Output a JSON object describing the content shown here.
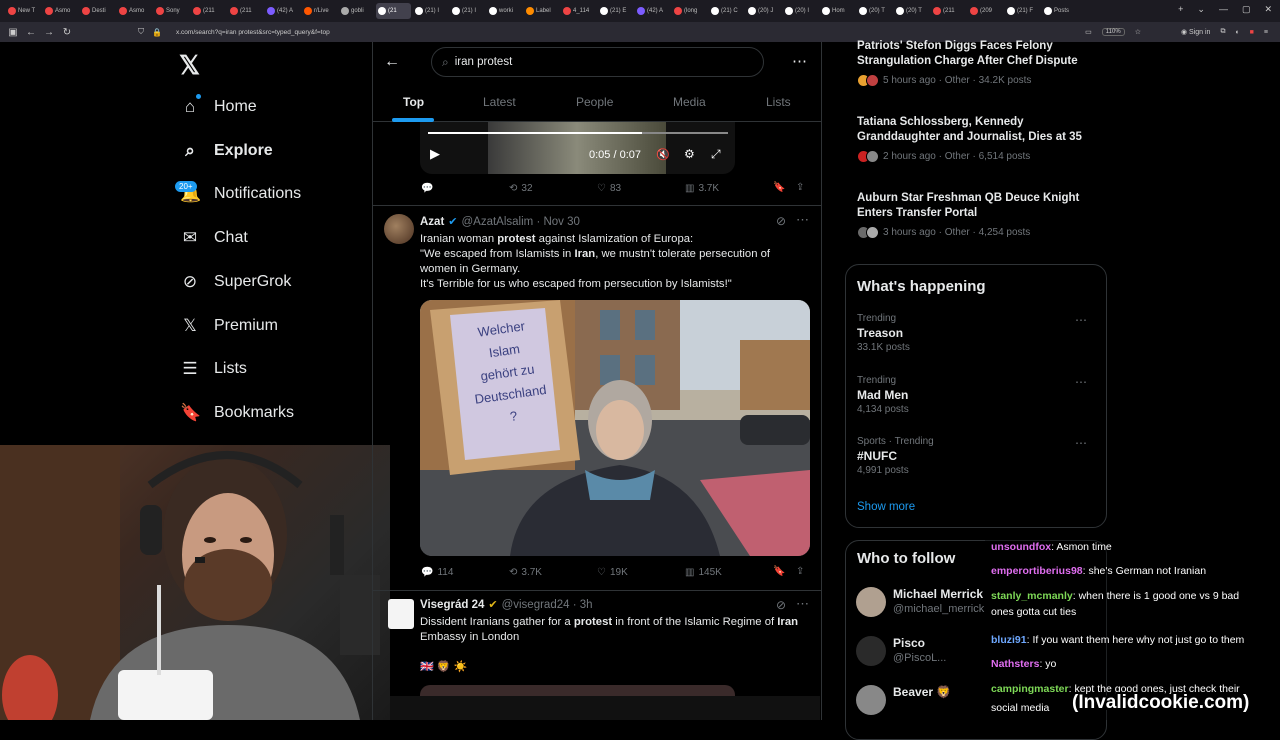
{
  "browser": {
    "tabs": [
      {
        "label": "New T",
        "color": "#e44"
      },
      {
        "label": "Asmo",
        "color": "#e44"
      },
      {
        "label": "Desti",
        "color": "#e44"
      },
      {
        "label": "Asmo",
        "color": "#e44"
      },
      {
        "label": "Sony",
        "color": "#e44"
      },
      {
        "label": "(211",
        "color": "#e44"
      },
      {
        "label": "(211",
        "color": "#e44"
      },
      {
        "label": "(42) A",
        "color": "#7c5cff"
      },
      {
        "label": "r/Live",
        "color": "#ff5700"
      },
      {
        "label": "gobli",
        "color": "#aaa"
      },
      {
        "label": "(21",
        "color": "#fff",
        "active": true
      },
      {
        "label": "(21) I",
        "color": "#fff"
      },
      {
        "label": "(21) I",
        "color": "#fff"
      },
      {
        "label": "worki",
        "color": "#fff"
      },
      {
        "label": "Label",
        "color": "#ff8c00"
      },
      {
        "label": "4_114",
        "color": "#e44"
      },
      {
        "label": "(21) E",
        "color": "#fff"
      },
      {
        "label": "(42) A",
        "color": "#7c5cff"
      },
      {
        "label": "(long",
        "color": "#e44"
      },
      {
        "label": "(21) C",
        "color": "#fff"
      },
      {
        "label": "(20) J",
        "color": "#fff"
      },
      {
        "label": "(20) I",
        "color": "#fff"
      },
      {
        "label": "Hom",
        "color": "#fff"
      },
      {
        "label": "(20) T",
        "color": "#fff"
      },
      {
        "label": "(20) T",
        "color": "#fff"
      },
      {
        "label": "(211",
        "color": "#e44"
      },
      {
        "label": "(209",
        "color": "#e44"
      },
      {
        "label": "(21) F",
        "color": "#fff"
      },
      {
        "label": "Posts",
        "color": "#fff"
      }
    ],
    "url": "x.com/search?q=iran protest&src=typed_query&f=top",
    "zoom": "110%",
    "signin": "Sign in"
  },
  "sidebar": {
    "items": [
      {
        "label": "Home",
        "icon": "home-icon",
        "glyph": "⌂"
      },
      {
        "label": "Explore",
        "icon": "search-icon",
        "glyph": "⌕"
      },
      {
        "label": "Notifications",
        "icon": "bell-icon",
        "glyph": "🔔"
      },
      {
        "label": "Chat",
        "icon": "mail-icon",
        "glyph": "✉"
      },
      {
        "label": "SuperGrok",
        "icon": "grok-icon",
        "glyph": "⊘"
      },
      {
        "label": "Premium",
        "icon": "x-icon",
        "glyph": "𝕏"
      },
      {
        "label": "Lists",
        "icon": "list-icon",
        "glyph": "☰"
      },
      {
        "label": "Bookmarks",
        "icon": "bookmark-icon",
        "glyph": "🔖"
      }
    ],
    "badge": "20+"
  },
  "search": {
    "query": "iran protest"
  },
  "tabs": [
    "Top",
    "Latest",
    "People",
    "Media",
    "Lists"
  ],
  "video": {
    "time": "0:05 / 0:07"
  },
  "tweet0_actions": {
    "retweets": "32",
    "likes": "83",
    "views": "3.7K"
  },
  "tweet1": {
    "name": "Azat",
    "handle": "@AzatAlsalim · Nov 30",
    "lines": [
      {
        "a": "Iranian woman ",
        "b": "protest",
        "c": " against Islamization of Europa:"
      },
      {
        "a": "\"We escaped from Islamists in ",
        "b": "Iran",
        "c": ", we mustn't tolerate persecution of"
      },
      {
        "a": "women in Germany.",
        "b": "",
        "c": ""
      },
      {
        "a": "It's Terrible for us who escaped from persecution by Islamists!\"",
        "b": "",
        "c": ""
      }
    ],
    "sign": [
      "Welcher",
      "Islam",
      "gehört zu",
      "Deutschland",
      "?"
    ],
    "replies": "114",
    "retweets": "3.7K",
    "likes": "19K",
    "views": "145K"
  },
  "tweet2": {
    "name": "Visegrád 24",
    "handle": "@visegrad24 · 3h",
    "line1a": "Dissident Iranians gather for a ",
    "line1b": "protest",
    "line1c": " in front of the Islamic Regime of ",
    "line1d": "Iran",
    "line2": "Embassy in London",
    "emojis": "🇬🇧 🦁 ☀️"
  },
  "news": [
    {
      "title1": "Patriots' Stefon Diggs Faces Felony",
      "title2": "Strangulation Charge After Chef Dispute",
      "meta": "5 hours ago · Other · 34.2K posts"
    },
    {
      "title1": "Tatiana Schlossberg, Kennedy",
      "title2": "Granddaughter and Journalist, Dies at 35",
      "meta": "2 hours ago · Other · 6,514 posts"
    },
    {
      "title1": "Auburn Star Freshman QB Deuce Knight",
      "title2": "Enters Transfer Portal",
      "meta": "3 hours ago · Other · 4,254 posts"
    }
  ],
  "happening": {
    "title": "What's happening",
    "trends": [
      {
        "cat": "Trending",
        "name": "Treason",
        "posts": "33.1K posts"
      },
      {
        "cat": "Trending",
        "name": "Mad Men",
        "posts": "4,134 posts"
      },
      {
        "cat": "Sports · Trending",
        "name": "#NUFC",
        "posts": "4,991 posts"
      }
    ],
    "show_more": "Show more"
  },
  "follow": {
    "title": "Who to follow",
    "users": [
      {
        "name": "Michael Merrick",
        "handle": "@michael_merrick"
      },
      {
        "name": "Pisco",
        "handle": "@PiscoL..."
      },
      {
        "name": "Beaver 🦁",
        "handle": ""
      }
    ]
  },
  "chat": [
    {
      "user": "unsoundfox",
      "msg": "Asmon time",
      "color": "#e06ef0"
    },
    {
      "user": "emperortiberius98",
      "msg": "she's German not Iranian",
      "color": "#e06ef0"
    },
    {
      "user": "stanly_mcmanly",
      "msg": "when there is 1 good one vs 9 bad",
      "color": "#7ed957"
    },
    {
      "user": "",
      "msg": "ones gotta cut ties",
      "color": "#fff"
    },
    {
      "user": "bluzi91",
      "msg": "If you want them here why not just go to them",
      "color": "#6ea8ff"
    },
    {
      "user": "Nathsters",
      "msg": "yo",
      "color": "#e06ef0"
    },
    {
      "user": "campingmaster",
      "msg": "kept the good ones, just check their",
      "color": "#7ed957"
    },
    {
      "user": "",
      "msg": "social media",
      "color": "#fff"
    }
  ],
  "watermark": "(Invalidcookie.com)"
}
